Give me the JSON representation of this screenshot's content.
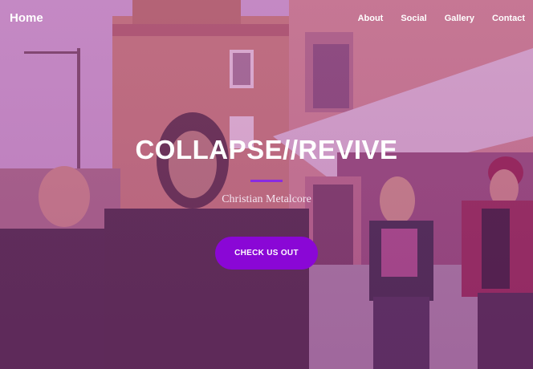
{
  "nav": {
    "brand": "Home",
    "items": [
      {
        "label": "About"
      },
      {
        "label": "Social"
      },
      {
        "label": "Gallery"
      },
      {
        "label": "Contact"
      }
    ]
  },
  "hero": {
    "title": "COLLAPSE//REVIVE",
    "subtitle": "Christian Metalcore",
    "cta_label": "CHECK US OUT"
  },
  "colors": {
    "accent": "#8a07d6",
    "divider": "#8a2be2",
    "overlay_tint": "#b040a0"
  }
}
